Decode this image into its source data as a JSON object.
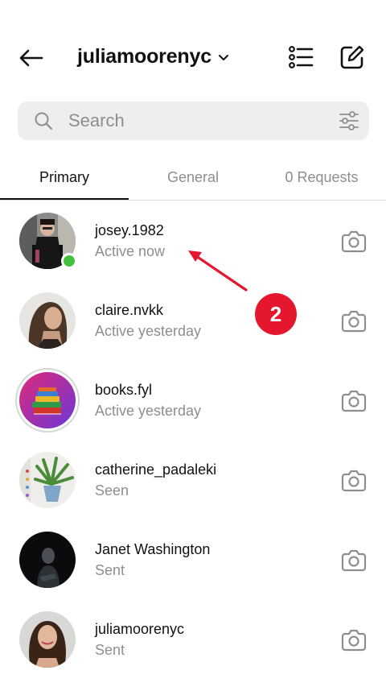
{
  "header": {
    "account_name": "juliamoorenyc",
    "back_icon": "arrow-left-icon",
    "chevron_icon": "chevron-down-icon",
    "list_icon": "list-icon",
    "edit_icon": "compose-icon"
  },
  "search": {
    "placeholder": "Search",
    "icon": "search-icon",
    "filter_icon": "filter-sliders-icon"
  },
  "tabs": [
    {
      "label": "Primary",
      "active": true
    },
    {
      "label": "General",
      "active": false
    },
    {
      "label": "0 Requests",
      "active": false
    }
  ],
  "conversations": [
    {
      "name": "josey.1982",
      "status": "Active now",
      "online": true
    },
    {
      "name": "claire.nvkk",
      "status": "Active yesterday",
      "online": false
    },
    {
      "name": "books.fyl",
      "status": "Active yesterday",
      "online": false,
      "story_ring": true
    },
    {
      "name": "catherine_padaleki",
      "status": "Seen",
      "online": false
    },
    {
      "name": "Janet Washington",
      "status": "Sent",
      "online": false
    },
    {
      "name": "juliamoorenyc",
      "status": "Sent",
      "online": false
    }
  ],
  "annotation": {
    "marker_number": "2",
    "marker_color": "#e5172f"
  },
  "colors": {
    "online": "#44c13c",
    "secondary_text": "#8e8e8e",
    "search_bg": "#eeeeef"
  }
}
